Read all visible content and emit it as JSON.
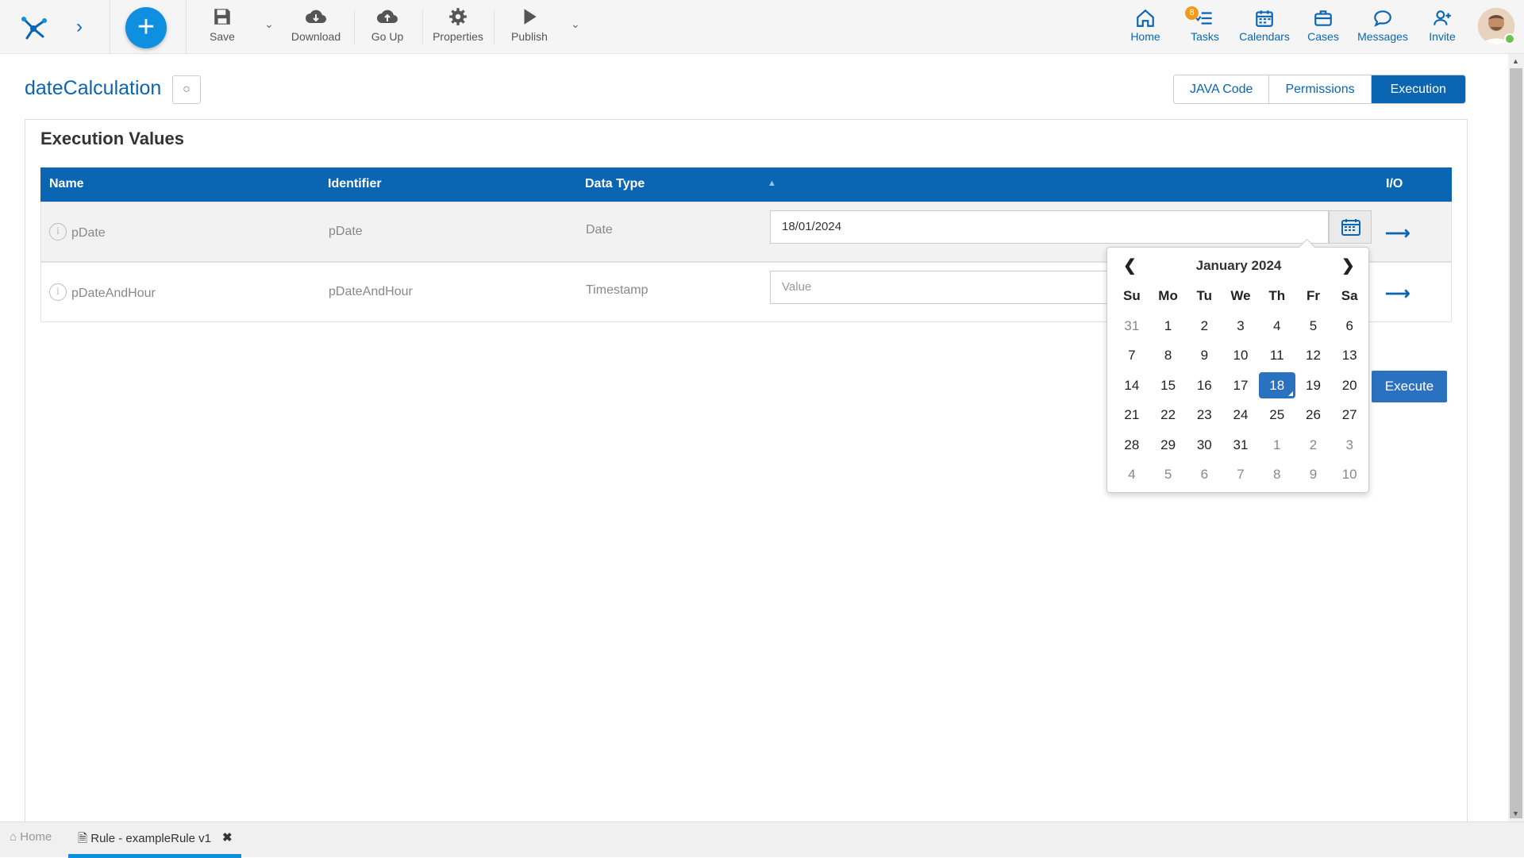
{
  "toolbar": {
    "save": "Save",
    "download": "Download",
    "go_up": "Go Up",
    "properties": "Properties",
    "publish": "Publish"
  },
  "nav": {
    "home": "Home",
    "tasks": "Tasks",
    "tasks_badge": "8",
    "calendars": "Calendars",
    "cases": "Cases",
    "messages": "Messages",
    "invite": "Invite"
  },
  "page": {
    "title": "dateCalculation",
    "tabs": [
      "JAVA Code",
      "Permissions",
      "Execution"
    ],
    "active_tab": "Execution",
    "section_title": "Execution Values"
  },
  "table": {
    "headers": {
      "name": "Name",
      "identifier": "Identifier",
      "data_type": "Data Type",
      "io": "I/O"
    },
    "rows": [
      {
        "name": "pDate",
        "identifier": "pDate",
        "data_type": "Date",
        "value": "18/01/2024"
      },
      {
        "name": "pDateAndHour",
        "identifier": "pDateAndHour",
        "data_type": "Timestamp",
        "value": "",
        "placeholder": "Value"
      }
    ]
  },
  "execute_label": "Execute",
  "calendar": {
    "month_label": "January 2024",
    "weekdays": [
      "Su",
      "Mo",
      "Tu",
      "We",
      "Th",
      "Fr",
      "Sa"
    ],
    "weeks": [
      [
        "31",
        "1",
        "2",
        "3",
        "4",
        "5",
        "6"
      ],
      [
        "7",
        "8",
        "9",
        "10",
        "11",
        "12",
        "13"
      ],
      [
        "14",
        "15",
        "16",
        "17",
        "18",
        "19",
        "20"
      ],
      [
        "21",
        "22",
        "23",
        "24",
        "25",
        "26",
        "27"
      ],
      [
        "28",
        "29",
        "30",
        "31",
        "1",
        "2",
        "3"
      ],
      [
        "4",
        "5",
        "6",
        "7",
        "8",
        "9",
        "10"
      ]
    ],
    "selected_day": "18"
  },
  "bottom_tabs": {
    "home": "Home",
    "rule": "Rule - exampleRule v1"
  },
  "colors": {
    "primary": "#0a66b2",
    "accent": "#0e8fe0",
    "badge": "#f39a1c"
  }
}
